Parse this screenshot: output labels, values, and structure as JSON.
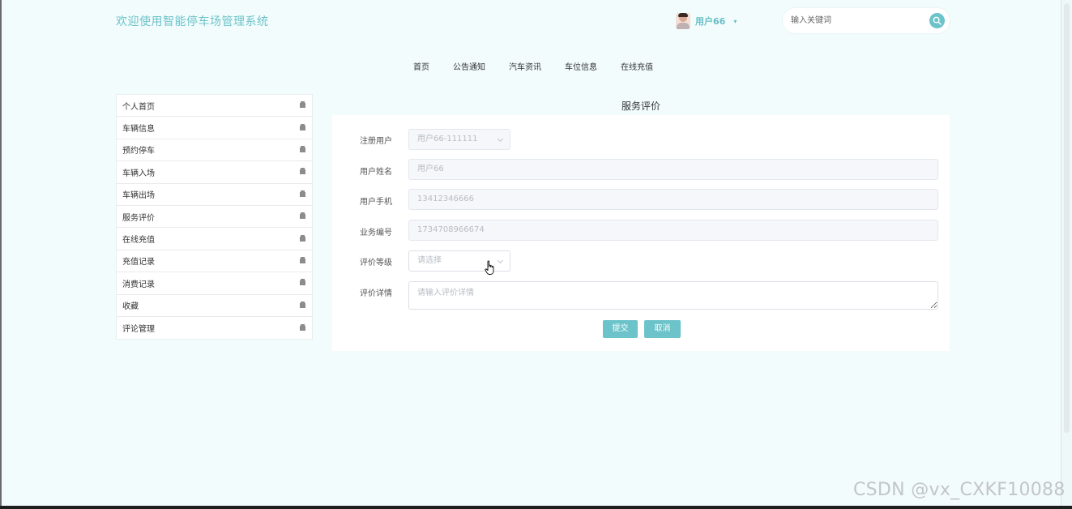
{
  "header": {
    "site_title": "欢迎使用智能停车场管理系统",
    "user_name": "用户66",
    "caret": "▾",
    "search_placeholder": "输入关键词"
  },
  "nav": {
    "items": [
      "首页",
      "公告通知",
      "汽车资讯",
      "车位信息",
      "在线充值"
    ]
  },
  "sidebar": {
    "items": [
      "个人首页",
      "车辆信息",
      "预约停车",
      "车辆入场",
      "车辆出场",
      "服务评价",
      "在线充值",
      "充值记录",
      "消费记录",
      "收藏",
      "评论管理"
    ]
  },
  "form": {
    "heading": "服务评价",
    "registered_user": {
      "label": "注册用户",
      "value": "用户66-111111"
    },
    "user_name": {
      "label": "用户姓名",
      "value": "用户66"
    },
    "user_phone": {
      "label": "用户手机",
      "value": "13412346666"
    },
    "business_no": {
      "label": "业务编号",
      "value": "1734708966674"
    },
    "rating_level": {
      "label": "评价等级",
      "placeholder": "请选择"
    },
    "review_detail": {
      "label": "评价详情",
      "placeholder": "请输入评价详情"
    },
    "submit_label": "提交",
    "cancel_label": "取消"
  },
  "watermark": "CSDN @vx_CXKF10088",
  "colors": {
    "accent": "#6cc3c9",
    "page_background": "#f2fcfc"
  },
  "icons": {
    "search": "search-icon",
    "side_item": "lock-icon",
    "select": "chevron-down-icon",
    "cursor": "hand-pointer-icon"
  }
}
